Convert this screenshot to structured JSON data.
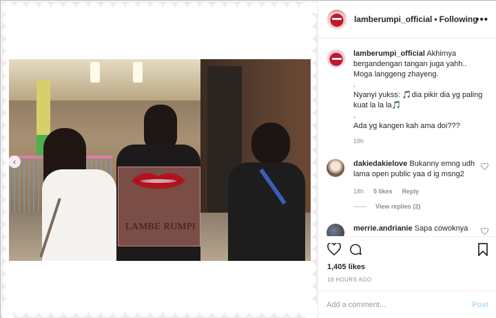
{
  "post": {
    "username": "lamberumpi_official",
    "follow_separator": "•",
    "follow_status": "Following",
    "more_label": "•••",
    "watermark": "LAMBE RUMPI",
    "caption_lines": [
      "Akhirnya bergandengan tangan juga yahh.. Moga langgeng zhayeng.",
      ".",
      "Nyanyi yukss: 🎵dia pikir dia yg paling kuat la la la🎵",
      ".",
      "Ada yg kangen kah ama doi???"
    ],
    "caption_time": "18h",
    "likes": "1,405 likes",
    "time_ago": "18 HOURS AGO"
  },
  "comments": [
    {
      "username": "dakiedakielove",
      "text": "Bukanny emng udh lama open public yaa d ig msng2",
      "time": "18h",
      "likes": "5 likes",
      "reply": "Reply",
      "view_replies": "View replies (2)"
    },
    {
      "username": "merrie.andrianie",
      "text": "Sapa cowoknya"
    }
  ],
  "composer": {
    "placeholder": "Add a comment...",
    "post_label": "Post"
  },
  "icons": {
    "heart": "heart-icon",
    "comment": "comment-icon",
    "save": "bookmark-icon",
    "more": "more-icon",
    "prev": "chevron-left-icon"
  },
  "colors": {
    "accent_post": "#b2dffc",
    "brand_red": "#c0182a"
  }
}
